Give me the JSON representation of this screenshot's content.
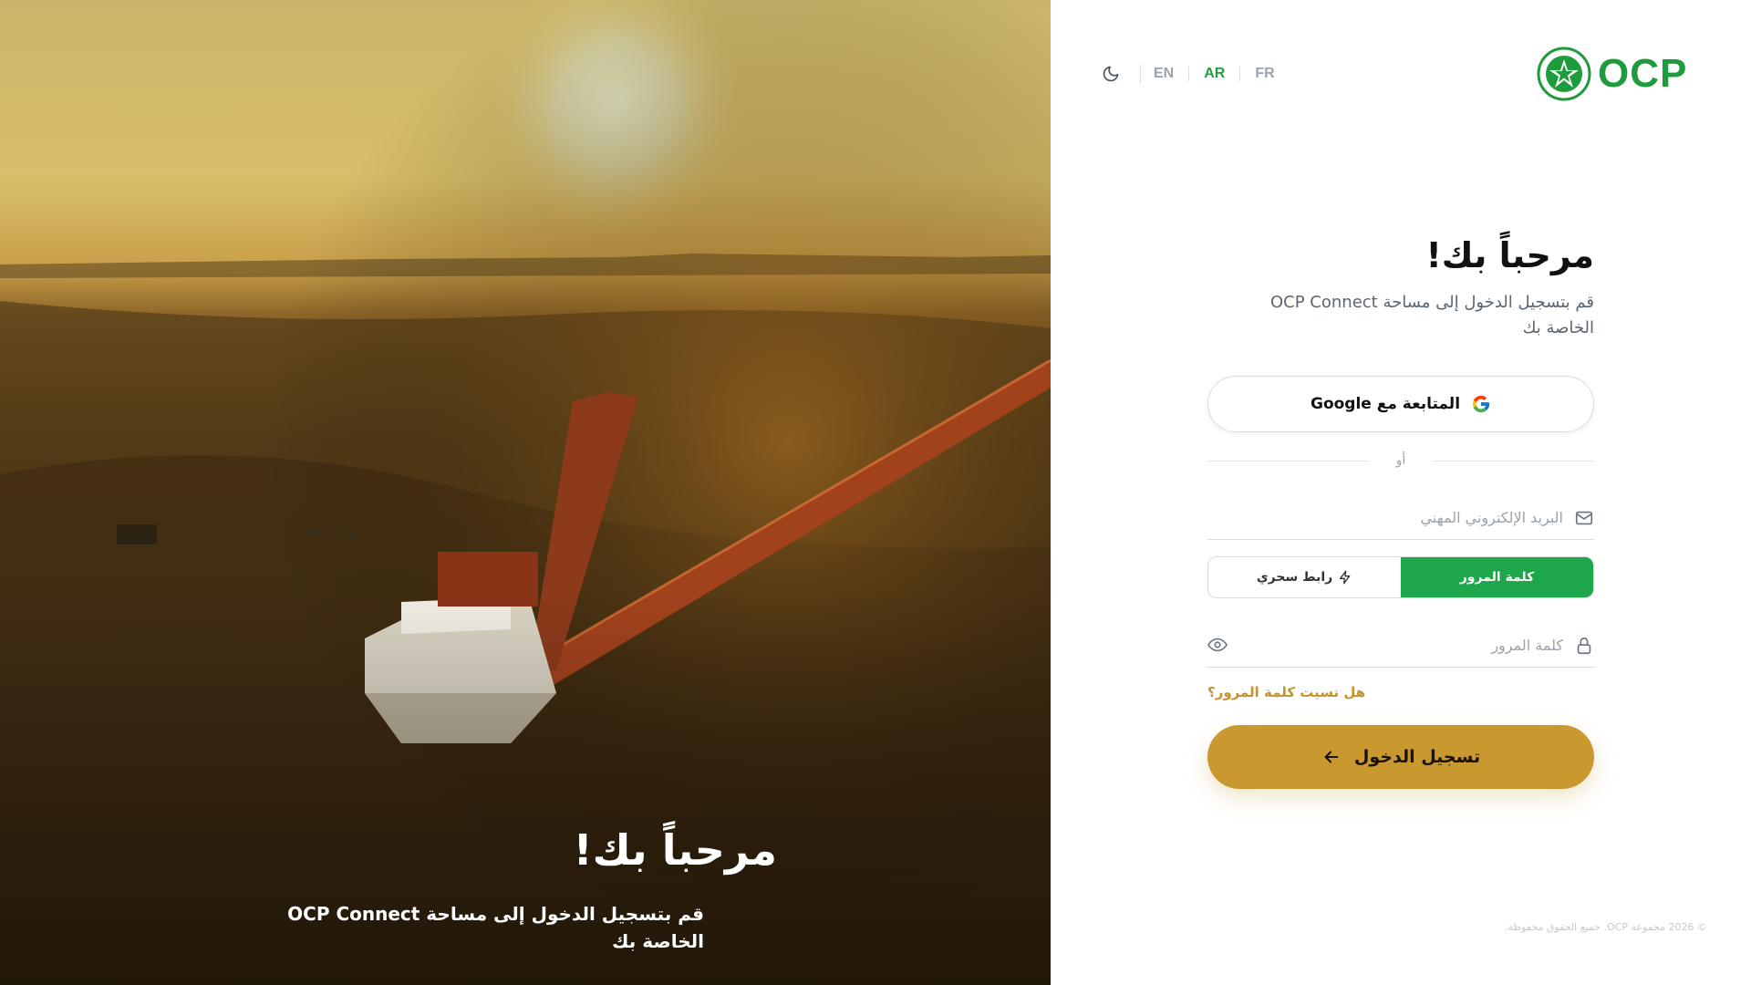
{
  "hero": {
    "title": "مرحباً بك!",
    "subtitle": "قم بتسجيل الدخول إلى مساحة OCP Connect الخاصة بك"
  },
  "topbar": {
    "theme_icon": "moon-icon",
    "languages": [
      "EN",
      "AR",
      "FR"
    ],
    "active_language": "AR"
  },
  "brand": {
    "logo_text": "OCP",
    "logo_icon": "ocp-star-emblem",
    "brand_color": "#1e9b3d"
  },
  "form": {
    "title": "مرحباً بك!",
    "subtitle": "قم بتسجيل الدخول إلى مساحة OCP Connect الخاصة بك",
    "google_label": "المتابعة مع Google",
    "or_label": "أو",
    "email_placeholder": "البريد الإلكتروني المهني",
    "toggle": {
      "password_label": "كلمة المرور",
      "magic_link_label": "رابط سحري",
      "active": "password"
    },
    "password_placeholder": "كلمة المرور",
    "forgot_label": "هل نسيت كلمة المرور؟",
    "submit_label": "تسجيل الدخول"
  },
  "footer": {
    "text": "© 2026 مجموعة OCP. جميع الحقوق محفوظة."
  },
  "colors": {
    "green": "#1ea64a",
    "gold": "#c9992f",
    "link_gold": "#c3942b"
  }
}
